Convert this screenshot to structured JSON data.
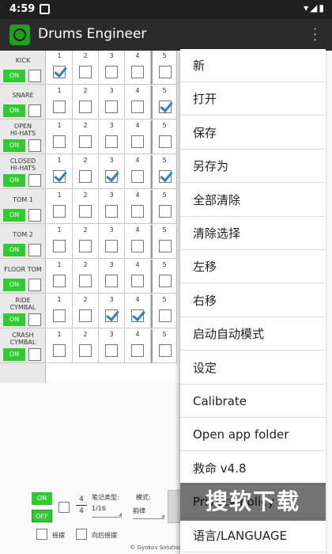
{
  "status_bar": {
    "time": "4:59"
  },
  "app_bar": {
    "title": "Drums Engineer",
    "overflow_icon": "overflow-menu-icon"
  },
  "on_label": "ON",
  "instruments": [
    {
      "name": "KICK",
      "checked": [
        1
      ]
    },
    {
      "name": "SNARE",
      "checked": [
        5
      ]
    },
    {
      "name": "OPEN\nHI-HATS",
      "checked": []
    },
    {
      "name": "CLOSED\nHI-HATS",
      "checked": [
        1,
        3,
        5
      ]
    },
    {
      "name": "TOM 1",
      "checked": []
    },
    {
      "name": "TOM 2",
      "checked": []
    },
    {
      "name": "FLOOR TOM",
      "checked": []
    },
    {
      "name": "RIDE\nCYMBAL",
      "checked": [
        3,
        4
      ]
    },
    {
      "name": "CRASH\nCYMBAL",
      "checked": []
    }
  ],
  "beat_numbers": [
    "1",
    "2",
    "3",
    "4",
    "5"
  ],
  "bottom": {
    "on": "ON",
    "off": "OFF",
    "time_sig_top": "4",
    "time_sig_bottom": "4",
    "note_type_label": "笔记类型:",
    "note_type_value": "1/16",
    "mode_label": "模式:",
    "mode_value": "韵律",
    "swing_label": "摇摆",
    "back_swing_label": "向后摇摆",
    "copyright": "© Gyokov Solutions"
  },
  "menu": [
    "新",
    "打开",
    "保存",
    "另存为",
    "全部清除",
    "清除选择",
    "左移",
    "右移",
    "启动自动模式",
    "设定",
    "Calibrate",
    "Open app folder",
    "救命 v4.8",
    "Privacy policy",
    "语言/LANGUAGE"
  ],
  "watermark": "搜软下载"
}
